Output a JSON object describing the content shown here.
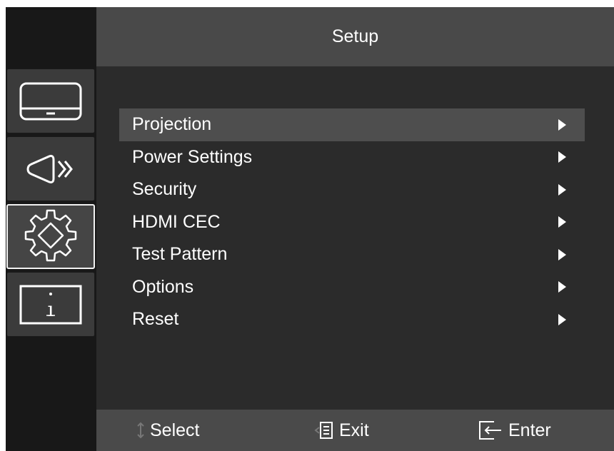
{
  "header": {
    "title": "Setup"
  },
  "sidebar": {
    "items": [
      {
        "name": "display",
        "icon": "monitor-icon",
        "active": false
      },
      {
        "name": "audio",
        "icon": "speaker-icon",
        "active": false
      },
      {
        "name": "setup",
        "icon": "gear-icon",
        "active": true
      },
      {
        "name": "info",
        "icon": "info-icon",
        "active": false
      }
    ]
  },
  "menu": {
    "items": [
      {
        "label": "Projection",
        "selected": true
      },
      {
        "label": "Power Settings",
        "selected": false
      },
      {
        "label": "Security",
        "selected": false
      },
      {
        "label": "HDMI CEC",
        "selected": false
      },
      {
        "label": "Test Pattern",
        "selected": false
      },
      {
        "label": "Options",
        "selected": false
      },
      {
        "label": "Reset",
        "selected": false
      }
    ]
  },
  "footer": {
    "select_label": "Select",
    "exit_label": "Exit",
    "enter_label": "Enter",
    "select_icon": "up-down-arrow-icon",
    "exit_icon": "exit-icon",
    "enter_icon": "enter-icon"
  },
  "colors": {
    "background": "#2b2b2b",
    "sidebar": "#181818",
    "header": "#494949",
    "footer": "#4a4a4a",
    "selected_row": "#4e4e4e",
    "text": "#ffffff"
  }
}
